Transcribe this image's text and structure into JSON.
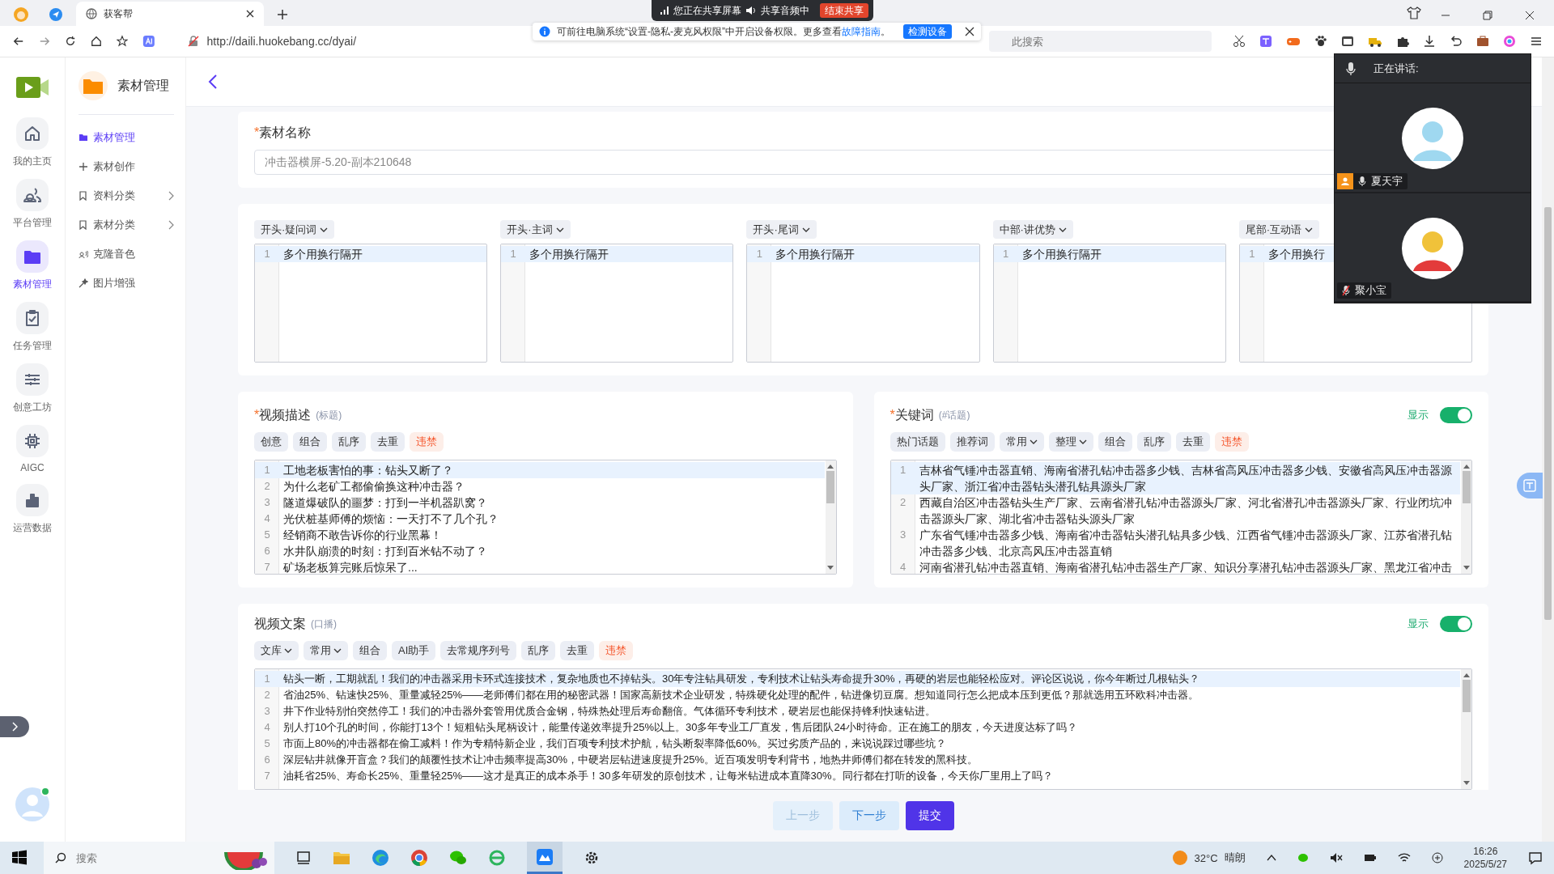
{
  "browser": {
    "tab": {
      "title": "获客帮",
      "selected": true
    },
    "url": "http://daili.huokebang.cc/dyai/",
    "search": {
      "placeholder": "此搜索"
    }
  },
  "share_bar": {
    "status": "您正在共享屏幕",
    "audio": "共享音频中",
    "stop": "结束共享"
  },
  "notice": {
    "text": "可前往电脑系统“设置-隐私-麦克风权限”中开启设备权限。更多查看",
    "link": "故障指南",
    "end": "。",
    "button": "检测设备"
  },
  "rail": [
    {
      "label": "我的主页",
      "selected": false
    },
    {
      "label": "平台管理",
      "selected": false
    },
    {
      "label": "素材管理",
      "selected": true
    },
    {
      "label": "任务管理",
      "selected": false
    },
    {
      "label": "创意工坊",
      "selected": false
    },
    {
      "label": "AIGC",
      "selected": false
    },
    {
      "label": "运营数据",
      "selected": false
    }
  ],
  "app_title": "素材管理",
  "menu": [
    {
      "label": "素材管理",
      "selected": true,
      "expandable": false
    },
    {
      "label": "素材创作",
      "selected": false,
      "expandable": false
    },
    {
      "label": "资料分类",
      "selected": false,
      "expandable": true
    },
    {
      "label": "素材分类",
      "selected": false,
      "expandable": true
    },
    {
      "label": "克隆音色",
      "selected": false,
      "expandable": false
    },
    {
      "label": "图片增强",
      "selected": false,
      "expandable": false
    }
  ],
  "name_field": {
    "label": "素材名称",
    "mark": "*",
    "value": "冲击器横屏-5.20-副本210648"
  },
  "columns": [
    {
      "label": "开头·疑问词",
      "lines": [
        {
          "n": "1",
          "text": "多个用换行隔开",
          "active": true
        }
      ]
    },
    {
      "label": "开头·主词",
      "lines": [
        {
          "n": "1",
          "text": "多个用换行隔开",
          "active": true
        }
      ]
    },
    {
      "label": "开头·尾词",
      "lines": [
        {
          "n": "1",
          "text": "多个用换行隔开",
          "active": true
        }
      ]
    },
    {
      "label": "中部·讲优势",
      "lines": [
        {
          "n": "1",
          "text": "多个用换行隔开",
          "active": true
        }
      ]
    },
    {
      "label": "尾部·互动语",
      "lines": [
        {
          "n": "1",
          "text": "多个用换行",
          "active": true
        }
      ]
    }
  ],
  "description": {
    "label": "视频描述",
    "hint": "(标题)",
    "mark": "*",
    "tools": [
      {
        "label": "创意",
        "kind": "tag"
      },
      {
        "label": "组合",
        "kind": "tag"
      },
      {
        "label": "乱序",
        "kind": "tag"
      },
      {
        "label": "去重",
        "kind": "tag"
      },
      {
        "label": "违禁",
        "kind": "danger"
      }
    ],
    "lines": [
      {
        "n": "1",
        "text": "工地老板害怕的事：钻头又断了？",
        "active": true
      },
      {
        "n": "2",
        "text": "为什么老矿工都偷偷换这种冲击器？",
        "active": false
      },
      {
        "n": "3",
        "text": "隧道爆破队的噩梦：打到一半机器趴窝？",
        "active": false
      },
      {
        "n": "4",
        "text": "光伏桩基师傅的烦恼：一天打不了几个孔？",
        "active": false
      },
      {
        "n": "5",
        "text": "经销商不敢告诉你的行业黑幕！",
        "active": false
      },
      {
        "n": "6",
        "text": "水井队崩溃的时刻：打到百米钻不动了？",
        "active": false
      },
      {
        "n": "7",
        "text": "矿场老板算完账后惊呆了...",
        "active": false
      }
    ]
  },
  "keywords": {
    "label": "关键词",
    "hint": "(#话题)",
    "mark": "*",
    "show": {
      "label": "显示",
      "on": true
    },
    "tools": [
      {
        "label": "热门话题",
        "kind": "tag"
      },
      {
        "label": "推荐词",
        "kind": "tag"
      },
      {
        "label": "常用",
        "kind": "dropdown"
      },
      {
        "label": "整理",
        "kind": "dropdown"
      },
      {
        "label": "组合",
        "kind": "tag"
      },
      {
        "label": "乱序",
        "kind": "tag"
      },
      {
        "label": "去重",
        "kind": "tag"
      },
      {
        "label": "违禁",
        "kind": "danger"
      }
    ],
    "lines": [
      {
        "n": "1",
        "text": "吉林省气锤冲击器直销、海南省潜孔钻冲击器多少钱、吉林省高风压冲击器多少钱、安徽省高风压冲击器源头厂家、浙江省冲击器钻头潜孔钻具源头厂家",
        "active": true
      },
      {
        "n": "2",
        "text": "西藏自治区冲击器钻头生产厂家、云南省潜孔钻冲击器源头厂家、河北省潜孔冲击器源头厂家、行业闭坑冲击器源头厂家、湖北省冲击器钻头源头厂家",
        "active": false
      },
      {
        "n": "3",
        "text": "广东省气锤冲击器多少钱、海南省冲击器钻头潜孔钻具多少钱、江西省气锤冲击器源头厂家、江苏省潜孔钻冲击器多少钱、北京高风压冲击器直销",
        "active": false
      },
      {
        "n": "4",
        "text": "河南省潜孔钻冲击器直销、海南省潜孔钻冲击器生产厂家、知识分享潜孔钻冲击器源头厂家、黑龙江省冲击",
        "active": false
      }
    ]
  },
  "script": {
    "label": "视频文案",
    "hint": "(口播)",
    "show": {
      "label": "显示",
      "on": true
    },
    "tools": [
      {
        "label": "文库",
        "kind": "dropdown"
      },
      {
        "label": "常用",
        "kind": "dropdown"
      },
      {
        "label": "组合",
        "kind": "tag"
      },
      {
        "label": "AI助手",
        "kind": "tag"
      },
      {
        "label": "去常规序列号",
        "kind": "tag"
      },
      {
        "label": "乱序",
        "kind": "tag"
      },
      {
        "label": "去重",
        "kind": "tag"
      },
      {
        "label": "违禁",
        "kind": "danger"
      }
    ],
    "lines": [
      {
        "n": "1",
        "text": "钻头一断，工期就乱！我们的冲击器采用卡环式连接技术，复杂地质也不掉钻头。30年专注钻具研发，专利技术让钻头寿命提升30%，再硬的岩层也能轻松应对。评论区说说，你今年断过几根钻头？",
        "active": true
      },
      {
        "n": "2",
        "text": "省油25%、钻速快25%、重量减轻25%——老师傅们都在用的秘密武器！国家高新技术企业研发，特殊硬化处理的配件，钻进像切豆腐。想知道同行怎么把成本压到更低？那就选用五环欧科冲击器。",
        "active": false
      },
      {
        "n": "3",
        "text": "井下作业特别怕突然停工！我们的冲击器外套管用优质合金钢，特殊热处理后寿命翻倍。气体循环专利技术，硬岩层也能保持锋利快速钻进。",
        "active": false
      },
      {
        "n": "4",
        "text": "别人打10个孔的时间，你能打13个！短粗钻头尾柄设计，能量传递效率提升25%以上。30多年专业工厂直发，售后团队24小时待命。正在施工的朋友，今天进度达标了吗？",
        "active": false
      },
      {
        "n": "5",
        "text": "市面上80%的冲击器都在偷工减料！作为专精特新企业，我们百项专利技术护航，钻头断裂率降低60%。买过劣质产品的，来说说踩过哪些坑？",
        "active": false
      },
      {
        "n": "6",
        "text": "深层钻井就像开盲盒？我们的颠覆性技术让冲击频率提高30%，中硬岩层钻进速度提升25%。近百项发明专利背书，地热井师傅们都在转发的黑科技。",
        "active": false
      },
      {
        "n": "7",
        "text": "油耗省25%、寿命长25%、重量轻25%——这才是真正的成本杀手！30多年研发的原创技术，让每米钻进成本直降30%。同行都在打听的设备，今天你厂里用上了吗？",
        "active": false
      }
    ]
  },
  "buttons": [
    {
      "label": "上一步",
      "kind": "disabled"
    },
    {
      "label": "下一步",
      "kind": "secondary"
    },
    {
      "label": "提交",
      "kind": "primary"
    }
  ],
  "meeting": {
    "title": "正在讲话:",
    "participants": [
      {
        "name": "夏天宇",
        "muted": false,
        "host": true
      },
      {
        "name": "聚小宝",
        "muted": true,
        "host": false
      }
    ]
  },
  "taskbar": {
    "search": {
      "placeholder": "搜索"
    },
    "weather": {
      "temp": "32°C",
      "text": "晴朗"
    },
    "time": "16:26",
    "date": "2025/5/27"
  }
}
